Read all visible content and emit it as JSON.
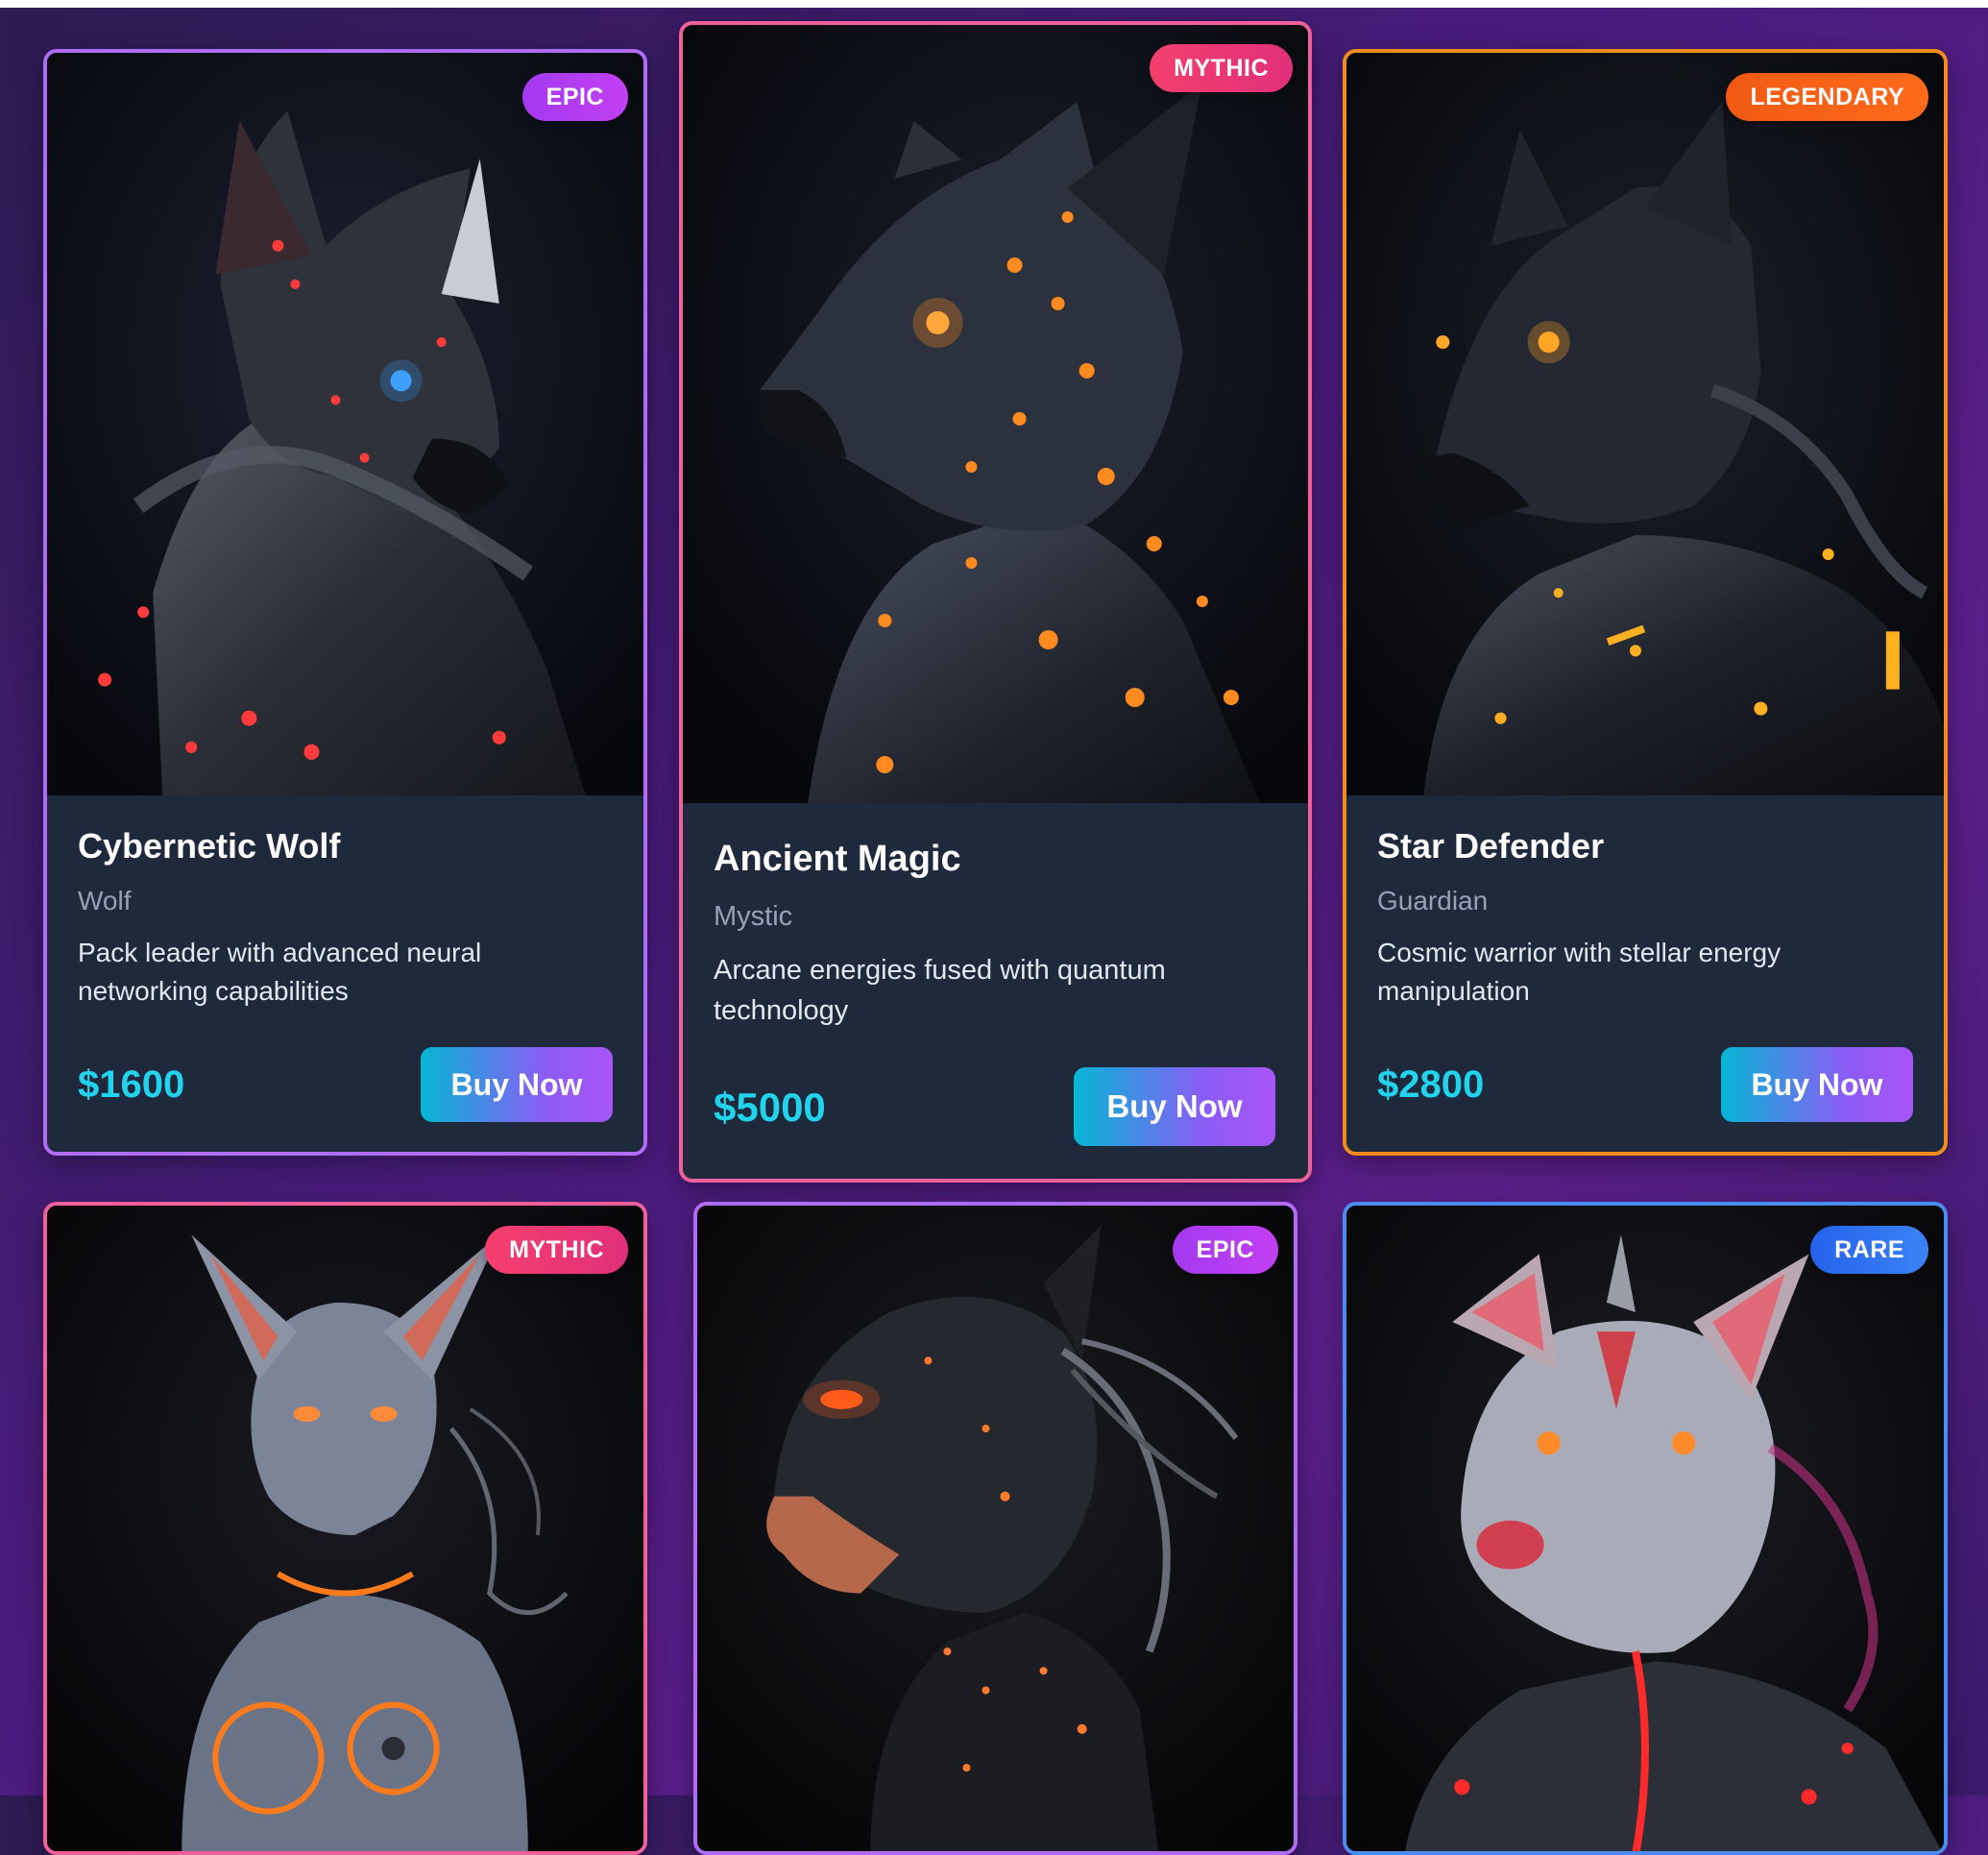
{
  "cards": [
    {
      "name": "Cybernetic Wolf",
      "type": "Wolf",
      "description": "Pack leader with advanced neural networking capabilities",
      "price": "$1600",
      "rarity": "EPIC",
      "button": "Buy Now",
      "accent": "#ff3b3b"
    },
    {
      "name": "Ancient Magic",
      "type": "Mystic",
      "description": "Arcane energies fused with quantum technology",
      "price": "$5000",
      "rarity": "MYTHIC",
      "button": "Buy Now",
      "accent": "#ff8a1f"
    },
    {
      "name": "Star Defender",
      "type": "Guardian",
      "description": "Cosmic warrior with stellar energy manipulation",
      "price": "$2800",
      "rarity": "LEGENDARY",
      "button": "Buy Now",
      "accent": "#ffb020"
    },
    {
      "rarity": "MYTHIC",
      "accent": "#ff7a1a"
    },
    {
      "rarity": "EPIC",
      "accent": "#ff5a1a"
    },
    {
      "rarity": "RARE",
      "accent": "#ff2a2a"
    }
  ],
  "colors": {
    "price": "#22d3ee",
    "epic": "#b06cf7",
    "mythic": "#f0609a",
    "legendary": "#f28c1a",
    "rare": "#4a8cf0"
  }
}
